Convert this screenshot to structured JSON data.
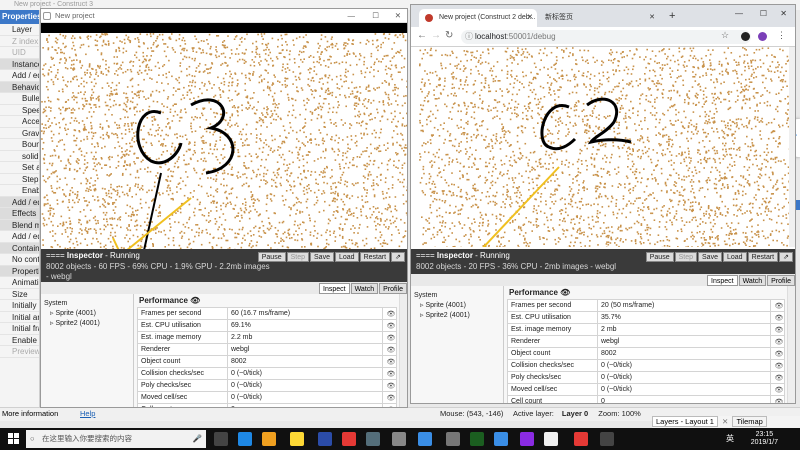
{
  "bg_window": {
    "title": "New project - Construct 3",
    "properties_header": "Properties",
    "rows": [
      "Layer",
      "Z index",
      "UID",
      "Instance",
      "Add / ed",
      "Behavio",
      "Bulle",
      "Spee",
      "Acce",
      "Grav",
      "Boun",
      "solid",
      "Set a",
      "Step",
      "Enab",
      "Add / ed",
      "Effects",
      "Blend m",
      "Add / ed",
      "Contain",
      "No cont",
      "Properti",
      "Animatio",
      "Size",
      "Initially",
      "Initial an",
      "Initial fra",
      "Enable c",
      "Preview"
    ],
    "more_info": "More information",
    "help": "Help",
    "status": {
      "mouse": "Mouse: (543, -146)",
      "active_layer_label": "Active layer:",
      "active_layer": "Layer 0",
      "zoom": "Zoom: 100%"
    },
    "bottom_tabs": {
      "layers": "Layers - Layout 1",
      "tilemap": "Tilemap"
    }
  },
  "left_window": {
    "title": "New project",
    "annotation": "C3",
    "inspector": {
      "title_prefix": "==== ",
      "title": "Inspector",
      "state": " - Running",
      "stats": "8002 objects - 60 FPS - 69% CPU - 1.9% GPU - 2.2mb images",
      "stats2": "- webgl",
      "buttons": [
        "Pause",
        "Step",
        "Save",
        "Load",
        "Restart",
        "⇗"
      ],
      "tabs": [
        "Inspect",
        "Watch",
        "Profile"
      ],
      "tree": {
        "root": "System",
        "children": [
          "Sprite (4001)",
          "Sprite2 (4001)"
        ]
      },
      "perf_header": "Performance",
      "rows": [
        {
          "label": "Frames per second",
          "value": "60 (16.7 ms/frame)"
        },
        {
          "label": "Est. CPU utilisation",
          "value": "69.1%"
        },
        {
          "label": "Est. image memory",
          "value": "2.2 mb"
        },
        {
          "label": "Renderer",
          "value": "webgl"
        },
        {
          "label": "Object count",
          "value": "8002"
        },
        {
          "label": "Collision checks/sec",
          "value": "0 (~0/tick)"
        },
        {
          "label": "Poly checks/sec",
          "value": "0 (~0/tick)"
        },
        {
          "label": "Moved cell/sec",
          "value": "0 (~0/tick)"
        },
        {
          "label": "Cell count",
          "value": "0"
        }
      ]
    }
  },
  "right_window": {
    "tabs": [
      "New project (Construct 2 deb...",
      "新标签页"
    ],
    "new_tab": "+",
    "url_host": "localhost",
    "url_path": ":50001/debug",
    "annotation": "C2",
    "inspector": {
      "title_prefix": "==== ",
      "title": "Inspector",
      "state": " - Running",
      "stats": "8002 objects - 20 FPS - 36% CPU - 2mb images - webgl",
      "buttons": [
        "Pause",
        "Step",
        "Save",
        "Load",
        "Restart",
        "⇗"
      ],
      "tabs": [
        "Inspect",
        "Watch",
        "Profile"
      ],
      "tree": {
        "root": "System",
        "children": [
          "Sprite (4001)",
          "Sprite2 (4001)"
        ]
      },
      "perf_header": "Performance",
      "rows": [
        {
          "label": "Frames per second",
          "value": "20 (50 ms/frame)"
        },
        {
          "label": "Est. CPU utilisation",
          "value": "35.7%"
        },
        {
          "label": "Est. image memory",
          "value": "2 mb"
        },
        {
          "label": "Renderer",
          "value": "webgl"
        },
        {
          "label": "Object count",
          "value": "8002"
        },
        {
          "label": "Collision checks/sec",
          "value": "0 (~0/tick)"
        },
        {
          "label": "Poly checks/sec",
          "value": "0 (~0/tick)"
        },
        {
          "label": "Moved cell/sec",
          "value": "0 (~0/tick)"
        },
        {
          "label": "Cell count",
          "value": "0"
        }
      ]
    }
  },
  "taskbar": {
    "search_placeholder": "在这里输入你要搜索的内容",
    "time": "23:15",
    "date": "2019/1/7",
    "lang": "英"
  },
  "colors": {
    "dots": "#c8924a",
    "annotation_arrow": "#f0c020",
    "inspector_bg": "#3a3a3a",
    "accent": "#3c78c8"
  }
}
